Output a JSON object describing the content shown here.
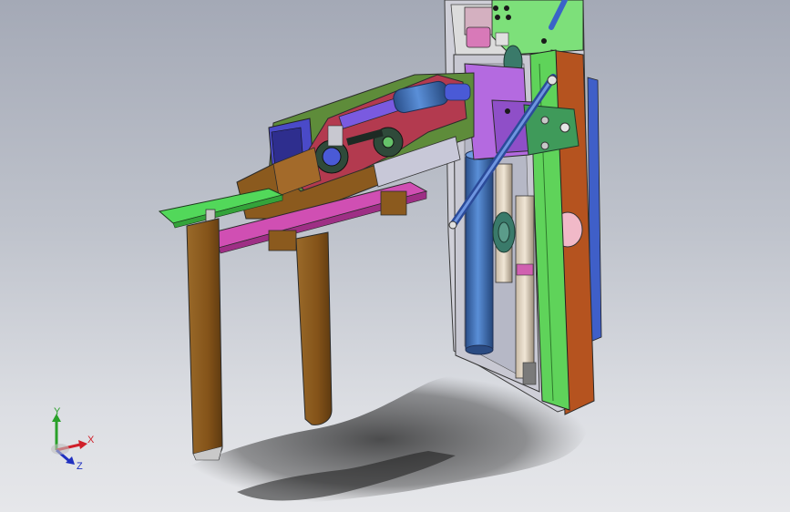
{
  "view": {
    "type": "3d-cad-viewport",
    "background_top": "#a4a9b6",
    "background_bottom": "#e6e7ea"
  },
  "model": {
    "colors": {
      "fork": "#8b5a1e",
      "fork_shadow": "#6a4312",
      "top_plate": "#5f8b3a",
      "back_housing": "#b33a4f",
      "magenta_bar": "#d04fb3",
      "green_bar": "#52d85a",
      "mast_green": "#5fd35a",
      "mast_brown": "#b34f20",
      "mast_grey": "#c9c9d4",
      "cylinder_blue": "#3a6fb8",
      "purple_block": "#a35fd6",
      "chain_dark": "#2e4a3a",
      "sprocket_blue": "#4a5ad6",
      "ground_shadow": "#2a2a2a"
    }
  },
  "triad": {
    "x_label": "X",
    "y_label": "Y",
    "z_label": "Z",
    "x_color": "#d0202a",
    "y_color": "#2aa02a",
    "z_color": "#2030c0"
  }
}
